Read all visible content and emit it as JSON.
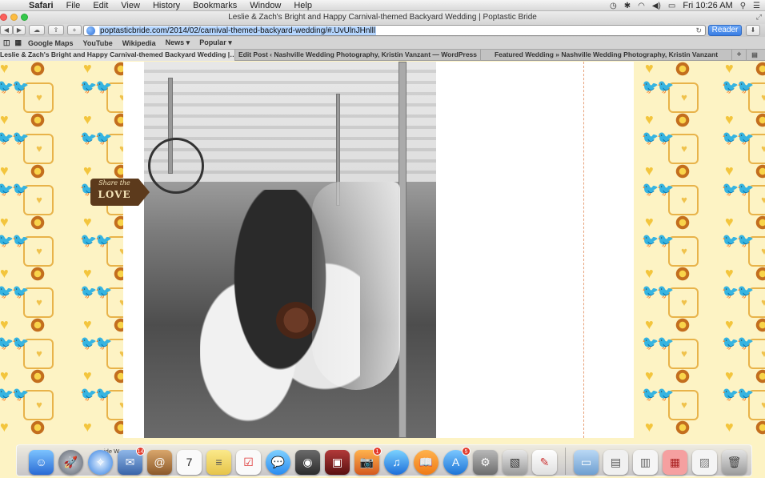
{
  "menubar": {
    "app": "Safari",
    "items": [
      "File",
      "Edit",
      "View",
      "History",
      "Bookmarks",
      "Window",
      "Help"
    ],
    "clock": "Fri 10:26 AM"
  },
  "window": {
    "title": "Leslie & Zach's Bright and Happy Carnival-themed Backyard Wedding | Poptastic Bride"
  },
  "toolbar": {
    "url": "poptasticbride.com/2014/02/carnival-themed-backyard-wedding/#.UvUlnJHnlll",
    "reader_label": "Reader"
  },
  "bookmarks": {
    "items": [
      "Google Maps",
      "YouTube",
      "Wikipedia",
      "News ▾",
      "Popular ▾"
    ]
  },
  "tabs": [
    {
      "label": "Leslie & Zach's Bright and Happy Carnival-themed Backyard Wedding |…",
      "active": true
    },
    {
      "label": "Edit Post ‹ Nashville Wedding Photography, Kristin Vanzant — WordPress",
      "active": false
    },
    {
      "label": "Featured Wedding » Nashville Wedding Photography, Kristin Vanzant",
      "active": false
    }
  ],
  "page": {
    "share_line1": "Share the",
    "share_line2": "LOVE"
  },
  "dock": {
    "hint": "ide    W    ."
  },
  "colors": {
    "pattern_bg": "#fdf3c4",
    "flower": "#c36e1e",
    "accent_yellow": "#f3c53d",
    "share_brown": "#5c3a1c"
  }
}
